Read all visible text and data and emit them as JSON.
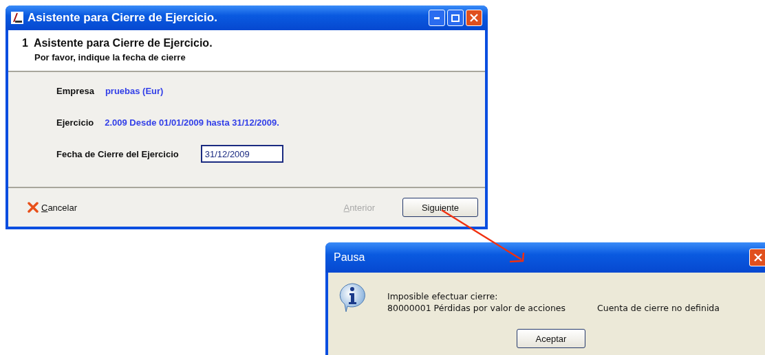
{
  "wizard_window": {
    "title": "Asistente para Cierre de Ejercicio.",
    "header": {
      "step": "1",
      "title": "Asistente para Cierre de Ejercicio.",
      "subtitle": "Por favor, indique la fecha de cierre"
    },
    "fields": [
      {
        "label": "Empresa",
        "kind": "info",
        "value": "pruebas (Eur)"
      },
      {
        "label": "Ejercicio",
        "kind": "info",
        "value": "2.009 Desde 01/01/2009 hasta 31/12/2009."
      },
      {
        "label": "Fecha de Cierre del Ejercicio",
        "kind": "input",
        "value": "31/12/2009"
      }
    ],
    "buttons": [
      {
        "label": "Cancelar",
        "kind": "flat",
        "disabled": false
      },
      {
        "label": "Anterior",
        "kind": "flat",
        "disabled": true
      },
      {
        "label": "Siguiente",
        "kind": "push",
        "disabled": false
      }
    ]
  },
  "message_window": {
    "title": "Pausa",
    "message": "Imposible efectuar cierre:",
    "account": "80000001 Pérdidas por valor de acciones",
    "status": "Cuenta de cierre no definida",
    "button": "Aceptar"
  }
}
